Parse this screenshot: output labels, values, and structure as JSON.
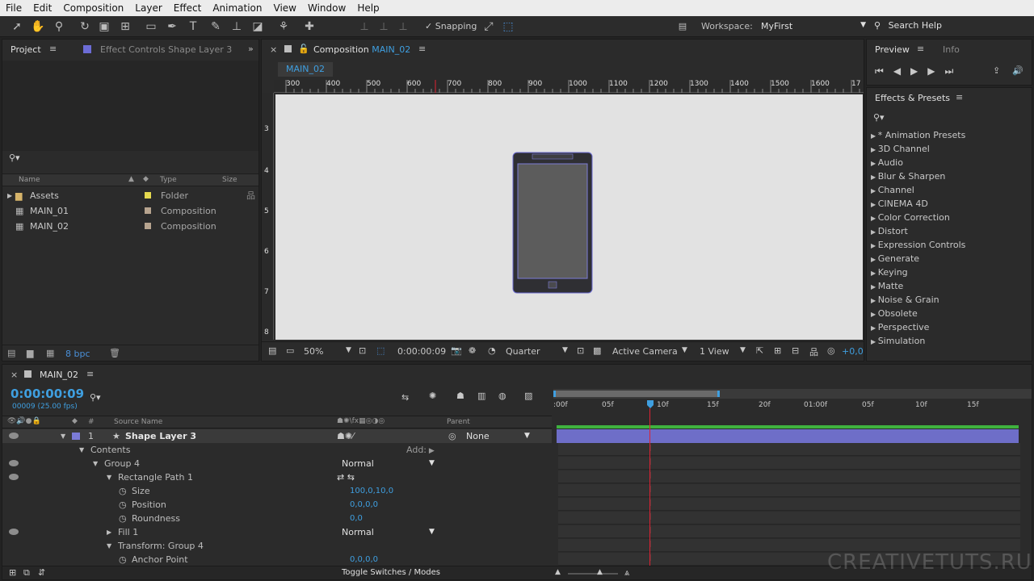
{
  "menu": [
    "File",
    "Edit",
    "Composition",
    "Layer",
    "Effect",
    "Animation",
    "View",
    "Window",
    "Help"
  ],
  "toolbar": {
    "snapping": "Snapping",
    "workspace_label": "Workspace:",
    "workspace_value": "MyFirst",
    "search_help": "Search Help"
  },
  "project": {
    "tab_project": "Project",
    "tab_effect_controls": "Effect Controls Shape Layer 3",
    "search_placeholder": "",
    "columns": {
      "name": "Name",
      "type": "Type",
      "size": "Size"
    },
    "items": [
      {
        "name": "Assets",
        "type": "Folder",
        "color": "#e5d94f"
      },
      {
        "name": "MAIN_01",
        "type": "Composition",
        "color": "#b7a48f"
      },
      {
        "name": "MAIN_02",
        "type": "Composition",
        "color": "#b7a48f"
      }
    ],
    "bpc": "8 bpc"
  },
  "composition": {
    "tab_label": "Composition",
    "comp_name": "MAIN_02",
    "sub_tab": "MAIN_02",
    "ruler_ticks": [
      "300",
      "400",
      "500",
      "600",
      "700",
      "800",
      "900",
      "1000",
      "1100",
      "1200",
      "1300",
      "1400",
      "1500",
      "1600",
      "17"
    ],
    "vruler_ticks": [
      "3",
      "4",
      "5",
      "6",
      "7",
      "8"
    ],
    "zoom": "50%",
    "timecode": "0:00:00:09",
    "resolution": "Quarter",
    "camera": "Active Camera",
    "views": "1 View",
    "exposure": "+0,0"
  },
  "preview": {
    "tab_preview": "Preview",
    "tab_info": "Info"
  },
  "effects": {
    "title": "Effects & Presets",
    "items": [
      "* Animation Presets",
      "3D Channel",
      "Audio",
      "Blur & Sharpen",
      "Channel",
      "CINEMA 4D",
      "Color Correction",
      "Distort",
      "Expression Controls",
      "Generate",
      "Keying",
      "Matte",
      "Noise & Grain",
      "Obsolete",
      "Perspective",
      "Simulation"
    ]
  },
  "timeline": {
    "tab": "MAIN_02",
    "timecode": "0:00:00:09",
    "frames": "00009 (25.00 fps)",
    "col_source": "Source Name",
    "col_parent": "Parent",
    "ruler": [
      ":00f",
      "05f",
      "10f",
      "15f",
      "20f",
      "01:00f",
      "05f",
      "10f",
      "15f"
    ],
    "layer": {
      "num": "1",
      "name": "Shape Layer 3",
      "parent": "None"
    },
    "rows": [
      {
        "label": "Contents",
        "indent": 1,
        "extra": "Add:"
      },
      {
        "label": "Group 4",
        "indent": 2,
        "mode": "Normal"
      },
      {
        "label": "Rectangle Path 1",
        "indent": 3
      },
      {
        "label": "Size",
        "indent": 4,
        "value": "100,0,10,0"
      },
      {
        "label": "Position",
        "indent": 4,
        "value": "0,0,0,0"
      },
      {
        "label": "Roundness",
        "indent": 4,
        "value": "0,0"
      },
      {
        "label": "Fill 1",
        "indent": 3,
        "mode": "Normal"
      },
      {
        "label": "Transform: Group 4",
        "indent": 3
      },
      {
        "label": "Anchor Point",
        "indent": 4,
        "value": "0,0,0,0"
      }
    ],
    "toggle": "Toggle Switches / Modes"
  },
  "watermark": "CREATIVETUTS.RU",
  "colors": {
    "accent": "#3f9fe0",
    "layer_label": "#7b7bd6"
  }
}
